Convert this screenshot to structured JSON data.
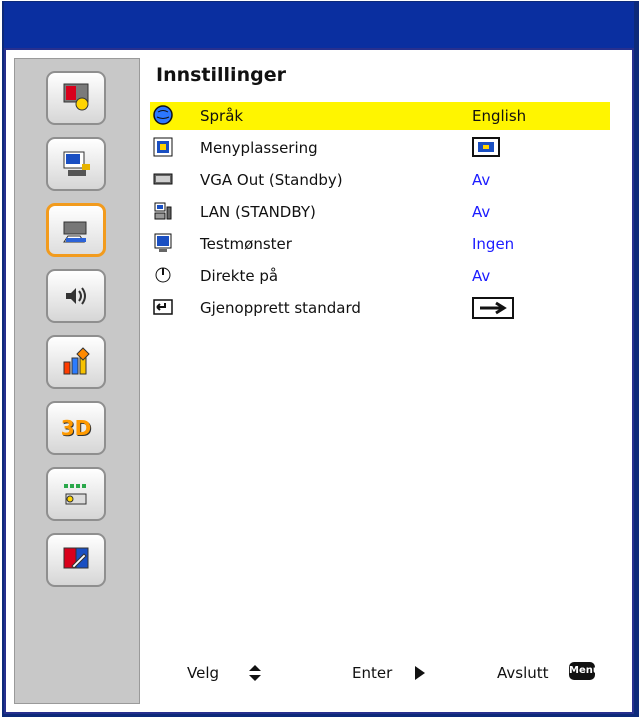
{
  "menu": {
    "title": "Innstillinger",
    "rows": [
      {
        "label": "Språk",
        "value": "English",
        "icon": "language-icon"
      },
      {
        "label": "Menyplassering",
        "value": "",
        "icon": "menu-position-icon"
      },
      {
        "label": "VGA Out (Standby)",
        "value": "Av",
        "icon": "vga-port-icon"
      },
      {
        "label": "LAN (STANDBY)",
        "value": "Av",
        "icon": "lan-icon"
      },
      {
        "label": "Testmønster",
        "value": "Ingen",
        "icon": "test-pattern-icon"
      },
      {
        "label": "Direkte på",
        "value": "Av",
        "icon": "power-icon"
      },
      {
        "label": "Gjenopprett standard",
        "value": "",
        "icon": "enter-icon"
      }
    ]
  },
  "sidebar": {
    "items": [
      {
        "icon": "image-settings-icon"
      },
      {
        "icon": "display-settings-icon"
      },
      {
        "icon": "setup-icon",
        "active": true
      },
      {
        "icon": "audio-icon"
      },
      {
        "icon": "options-icon"
      },
      {
        "icon": "3d-icon",
        "label": "3D"
      },
      {
        "icon": "network-icon"
      },
      {
        "icon": "interactive-icon"
      }
    ]
  },
  "footer": {
    "select_label": "Velg",
    "enter_label": "Enter",
    "exit_label": "Avslutt",
    "menu_key": "Menu"
  },
  "colors": {
    "top_bar": "#0a2fa0",
    "selected_row": "#fff500",
    "value_text": "#1c1cff",
    "active_border": "#f29b1d"
  }
}
